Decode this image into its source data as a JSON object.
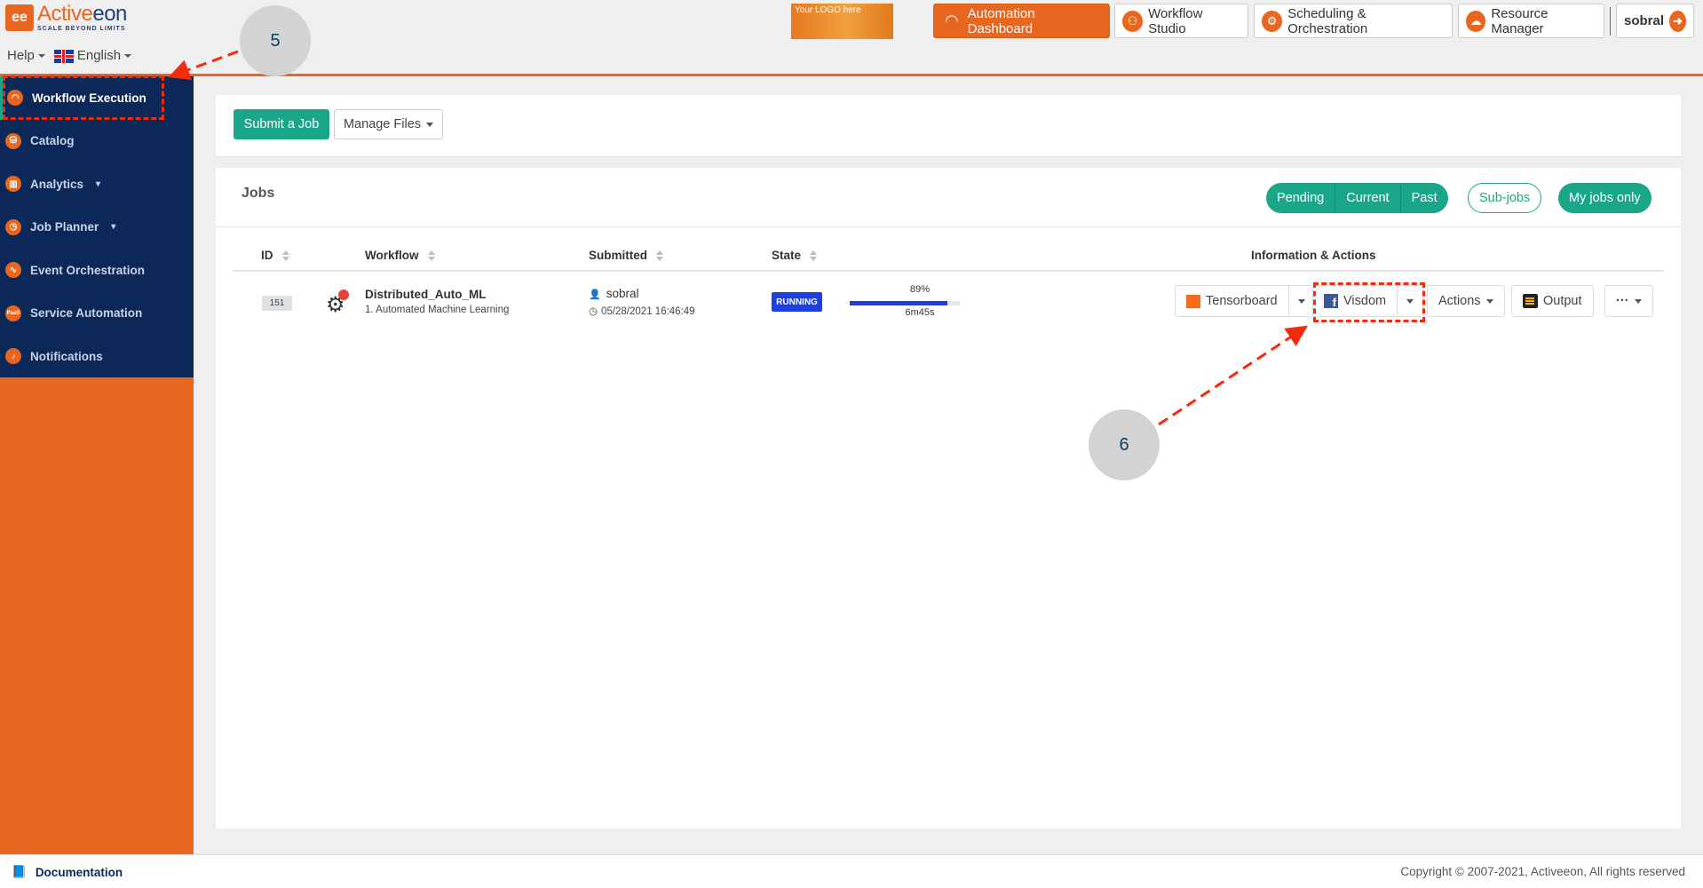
{
  "header": {
    "brand_name_a": "Active",
    "brand_name_b": "eon",
    "brand_tagline": "SCALE BEYOND LIMITS",
    "help_label": "Help",
    "language_label": "English",
    "your_logo_text": "Your LOGO here",
    "nav": [
      {
        "label": "Automation Dashboard",
        "icon": "gauge-icon",
        "active": true
      },
      {
        "label": "Workflow Studio",
        "icon": "workflow-icon",
        "active": false
      },
      {
        "label": "Scheduling & Orchestration",
        "icon": "gears-icon",
        "active": false
      },
      {
        "label": "Resource Manager",
        "icon": "cloud-icon",
        "active": false
      }
    ],
    "user": {
      "name": "sobral",
      "icon": "logout-arrow-icon"
    }
  },
  "sidebar": {
    "items": [
      {
        "label": "Workflow Execution",
        "icon": "gauge-icon",
        "active": true,
        "expandable": false
      },
      {
        "label": "Catalog",
        "icon": "catalog-icon",
        "active": false,
        "expandable": false
      },
      {
        "label": "Analytics",
        "icon": "analytics-icon",
        "active": false,
        "expandable": true
      },
      {
        "label": "Job Planner",
        "icon": "clock-icon",
        "active": false,
        "expandable": true
      },
      {
        "label": "Event Orchestration",
        "icon": "pulse-icon",
        "active": false,
        "expandable": false
      },
      {
        "label": "Service Automation",
        "icon": "paas-icon",
        "active": false,
        "expandable": false
      },
      {
        "label": "Notifications",
        "icon": "bell-icon",
        "active": false,
        "expandable": false
      }
    ]
  },
  "toolbar": {
    "submit_label": "Submit a Job",
    "manage_files_label": "Manage Files"
  },
  "jobs": {
    "title": "Jobs",
    "filters": {
      "segments": [
        "Pending",
        "Current",
        "Past"
      ],
      "subjobs_label": "Sub-jobs",
      "myjobs_label": "My jobs only"
    },
    "columns": {
      "id": "ID",
      "workflow": "Workflow",
      "submitted": "Submitted",
      "state": "State",
      "info": "Information & Actions"
    },
    "rows": [
      {
        "id": "151",
        "workflow_name": "Distributed_Auto_ML",
        "workflow_bucket": "1. Automated Machine Learning",
        "submitted_by": "sobral",
        "submitted_at": "05/28/2021 16:46:49",
        "state": "RUNNING",
        "progress_label": "89%",
        "progress_value": 0.89,
        "duration": "6m45s",
        "actions": {
          "tensorboard": "Tensorboard",
          "visdom": "Visdom",
          "actions": "Actions",
          "output": "Output",
          "more": "···"
        }
      }
    ]
  },
  "footer": {
    "documentation_label": "Documentation",
    "copyright": "Copyright © 2007-2021, Activeeon, All rights reserved"
  },
  "annotations": [
    {
      "number": "5",
      "target": "sidebar-item-workflow-execution"
    },
    {
      "number": "6",
      "target": "visdom-button"
    }
  ],
  "colors": {
    "brand_orange": "#e8661f",
    "sidebar_navy": "#0b2859",
    "accent_green": "#1aa789",
    "running_blue": "#1c3fe0",
    "annotation_red": "#f52a0a"
  }
}
